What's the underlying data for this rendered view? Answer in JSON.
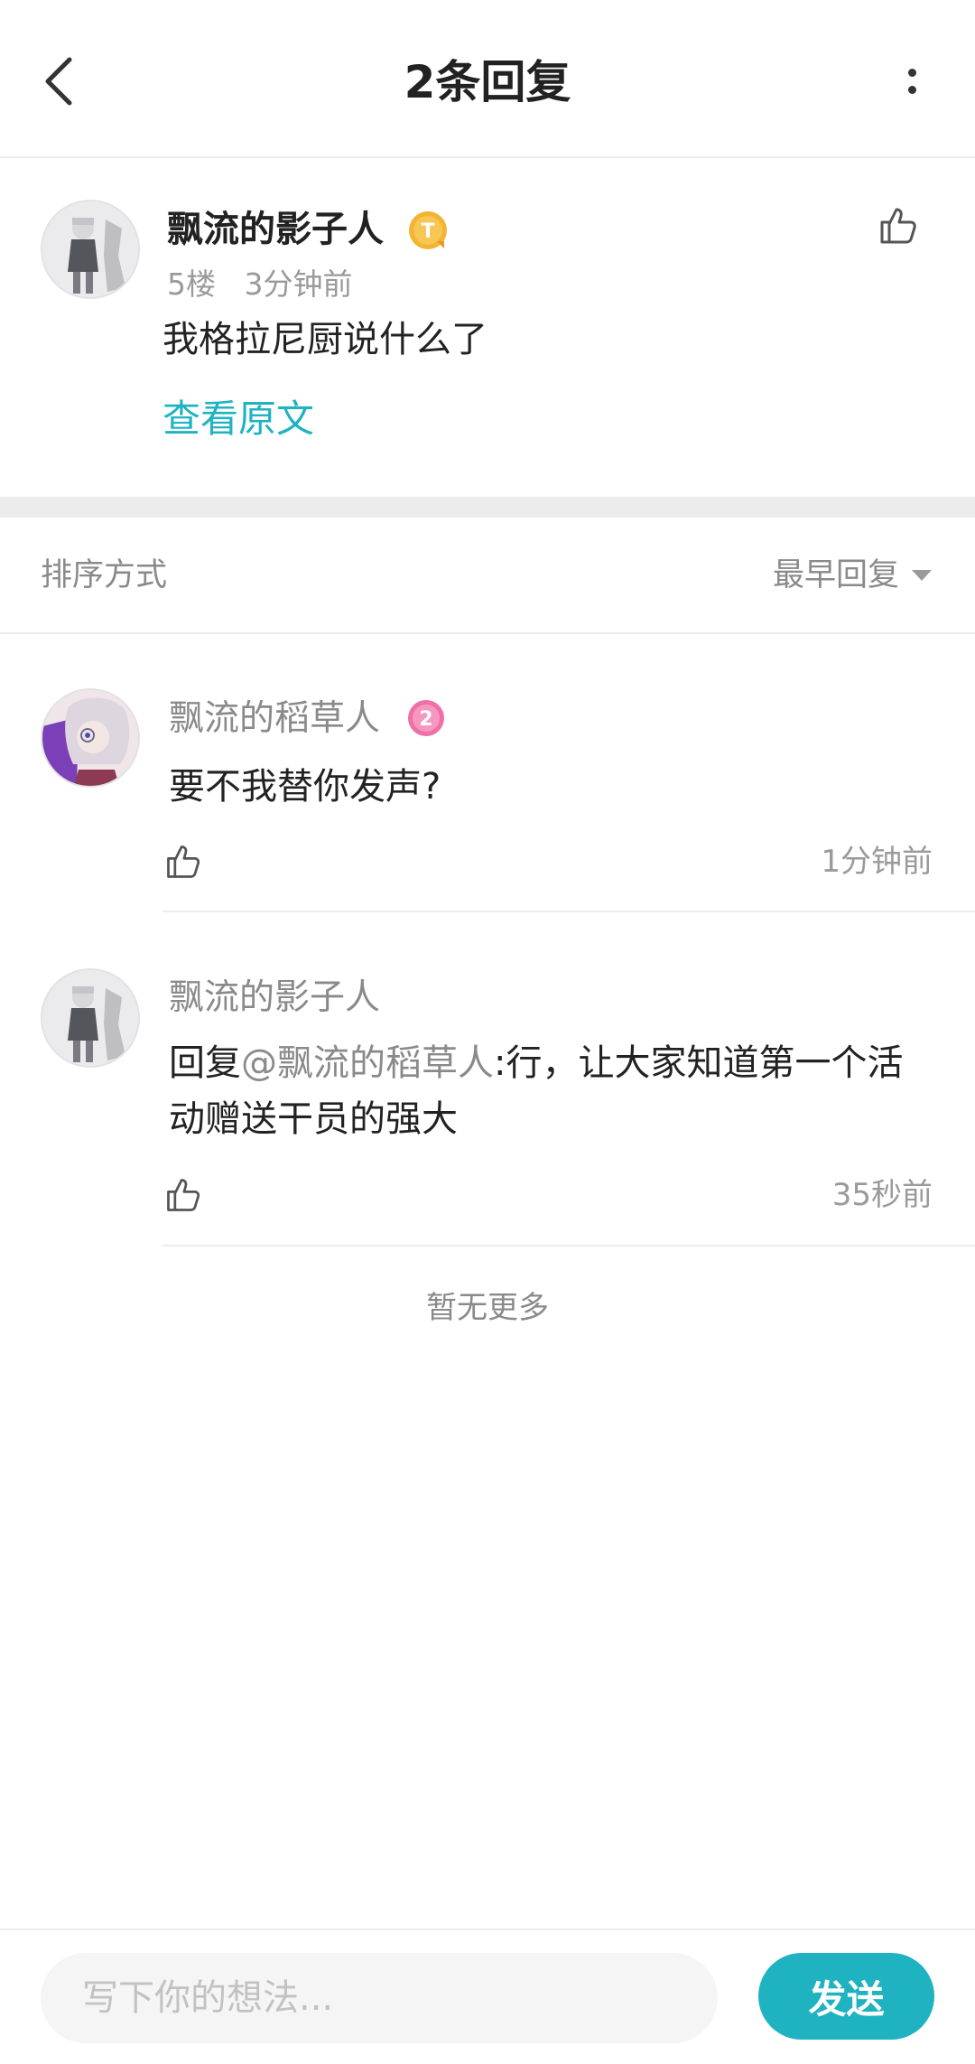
{
  "header": {
    "title": "2条回复",
    "back_icon": "chevron-left-icon",
    "more_icon": "more-vertical-icon"
  },
  "original_post": {
    "author": "飘流的影子人",
    "badge_icon": "gold-t-badge-icon",
    "floor": "5楼",
    "time": "3分钟前",
    "content": "我格拉尼厨说什么了",
    "view_original_label": "查看原文"
  },
  "sort": {
    "label": "排序方式",
    "selected": "最早回复"
  },
  "replies": [
    {
      "author": "飘流的稻草人",
      "badge_icon": "level-2-badge-icon",
      "content": "要不我替你发声?",
      "time": "1分钟前"
    },
    {
      "author": "飘流的影子人",
      "reply_prefix": "回复",
      "mention": "@飘流的稻草人",
      "content": ":行，让大家知道第一个活动赠送干员的强大",
      "time": "35秒前"
    }
  ],
  "no_more_text": "暂无更多",
  "composer": {
    "placeholder": "写下你的想法...",
    "send_label": "发送"
  },
  "colors": {
    "accent": "#1fb3c2",
    "text_primary": "#222222",
    "text_secondary": "#8a8a8a",
    "divider": "#ececec",
    "badge_gold": "#f2b431",
    "badge_pink": "#f06fa7"
  }
}
